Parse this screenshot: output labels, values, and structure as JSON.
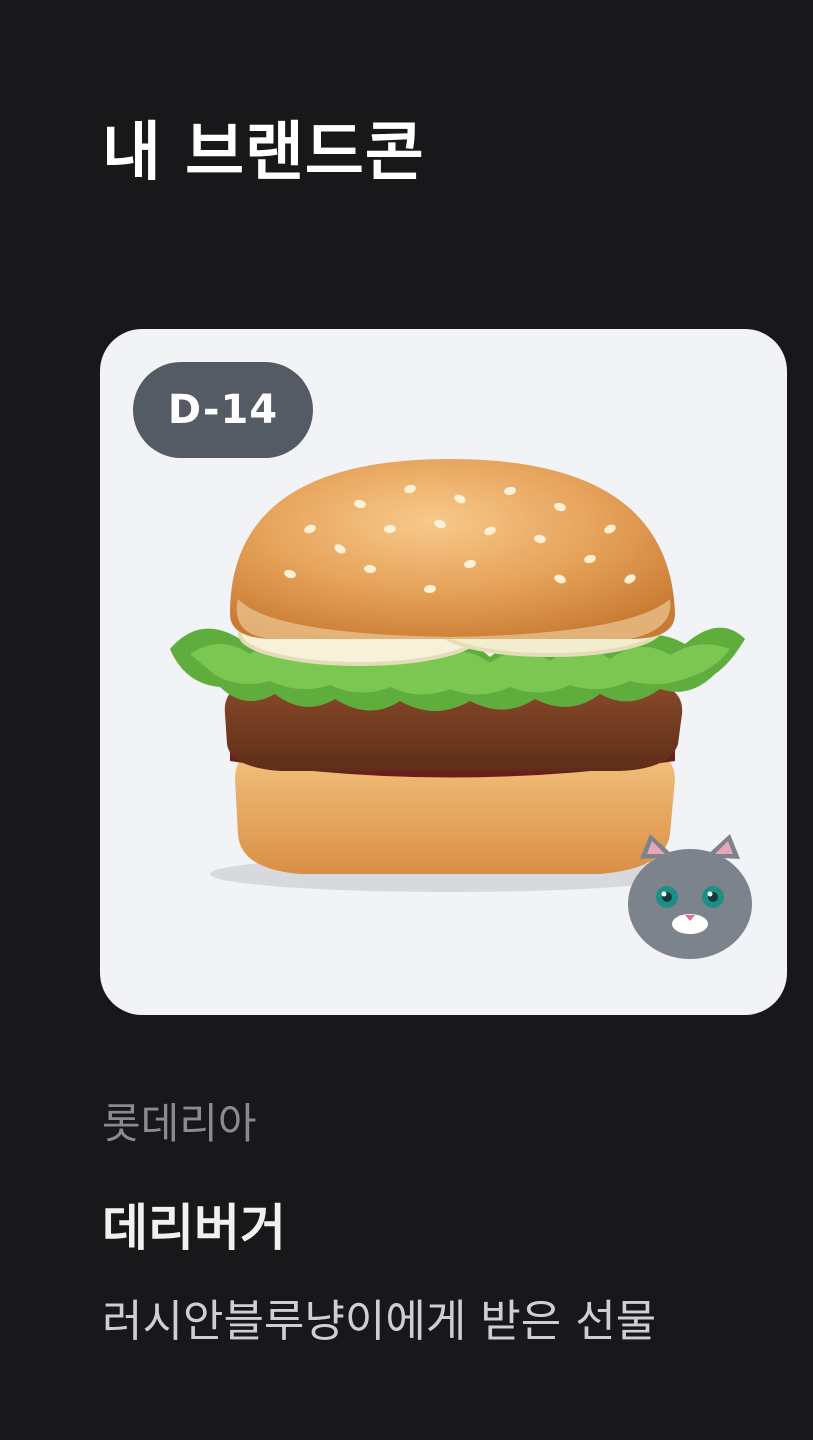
{
  "header": {
    "title": "내 브랜드콘"
  },
  "coupon": {
    "dday": "D-14",
    "brand": "롯데리아",
    "product": "데리버거",
    "gift_note": "러시안블루냥이에게 받은 선물",
    "image_icon": "burger-image",
    "sticker_icon": "cat-avatar-icon"
  },
  "colors": {
    "background": "#18181b",
    "card": "#f2f3f6",
    "badge": "#555b64"
  }
}
